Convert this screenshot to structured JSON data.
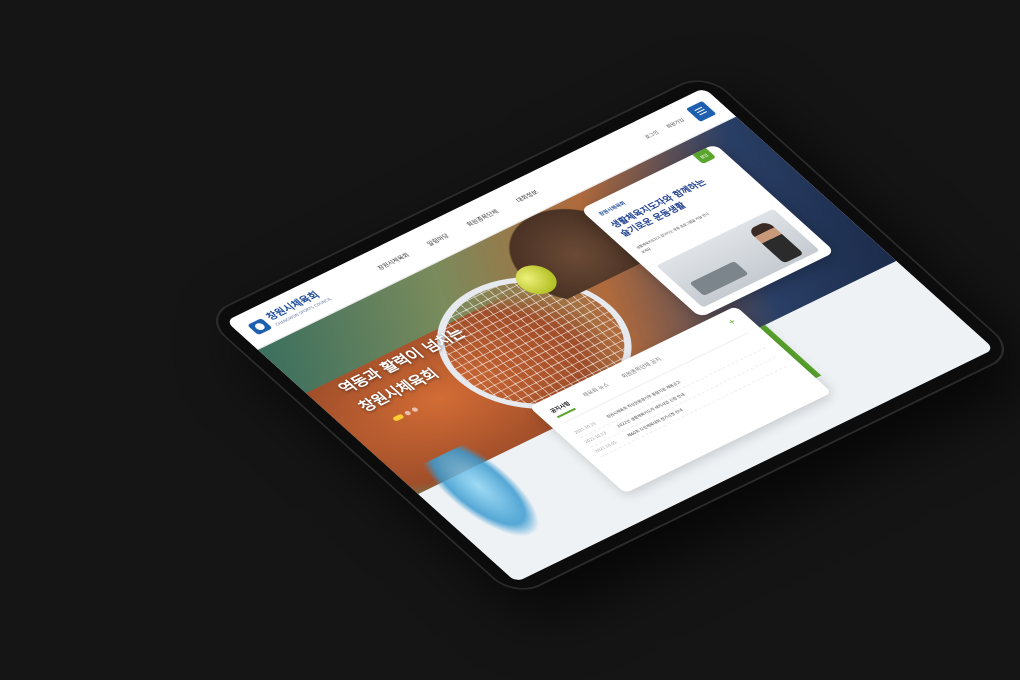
{
  "site": {
    "logo_ko": "창원시체육회",
    "logo_en": "CHANGWON SPORTS COUNCIL"
  },
  "nav": {
    "items": [
      "창원시체육회",
      "알림마당",
      "회원종목단체",
      "대회정보"
    ]
  },
  "util": {
    "login": "로그인",
    "join": "회원가입"
  },
  "hero": {
    "line1": "역동과 활력이 넘치는",
    "line2": "창원시체육회"
  },
  "promo": {
    "tag": "팝업",
    "logo": "창원시체육회",
    "title_line1": "생활체육지도자와 함께하는",
    "title_line2": "슬기로운 운동생활",
    "body": "생활체육지도자가 찾아가는 운동 프로그램을 지금 만나보세요"
  },
  "notice": {
    "tabs": [
      "공지사항",
      "체육회 뉴스",
      "회원종목단체 공지"
    ],
    "active_tab": 0,
    "more_icon": "plus-icon",
    "items": [
      {
        "date": "2021.10.15",
        "title": "창원시체육회 직장운동경기부 통합지원 채용공고"
      },
      {
        "date": "2021.10.13",
        "title": "2022년 생활체육지도자 배치사업 신청 안내"
      },
      {
        "date": "2021.10.05",
        "title": "제60회 도민체육대회 참가신청 안내"
      }
    ]
  },
  "colors": {
    "brand_blue": "#1f5fb0",
    "accent_green": "#5aa62d",
    "background": "#151515"
  }
}
